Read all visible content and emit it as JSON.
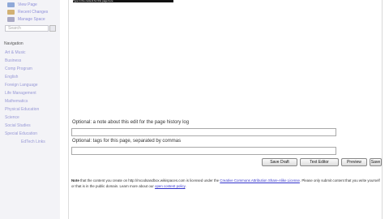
{
  "sidebar": {
    "links": [
      {
        "label": "View Page",
        "icon": "page-icon",
        "color": "#8fa9d8"
      },
      {
        "label": "Recent Changes",
        "icon": "changes-icon",
        "color": "#d2b173"
      },
      {
        "label": "Manage Space",
        "icon": "manage-icon",
        "color": "#a9a9c4"
      }
    ],
    "search": {
      "placeholder": "Search"
    },
    "navigation_heading": "Navigation",
    "nav_items": [
      "Art & Music",
      "Business",
      "Comp Program",
      "English",
      "Foreign Language",
      "Life Management",
      "Mathematics",
      "Physical Education",
      "Science",
      "Social Studies",
      "Special Education",
      "EdTech Links"
    ]
  },
  "editor": {
    "top_strip_text": "Type in the content for this page here"
  },
  "form": {
    "note_label": "Optional: a note about this edit for the page history log",
    "note_value": "",
    "tags_label": "Optional: tags for this page, separated by commas",
    "tags_value": ""
  },
  "buttons": {
    "save_draft": "Save Draft",
    "text_editor": "Text Editor",
    "preview": "Preview",
    "save": "Save"
  },
  "notice": {
    "note_word": "Note",
    "text_1": " that the content you create on http://mcodsandbox.wikispaces.com is licensed under the ",
    "license_link": "Creative Commons Attribution Share-Alike License",
    "text_2": ". Please only submit content that you write yourself or that is in the public domain. Learn more about our ",
    "policy_link": "open content policy",
    "text_3": "."
  }
}
